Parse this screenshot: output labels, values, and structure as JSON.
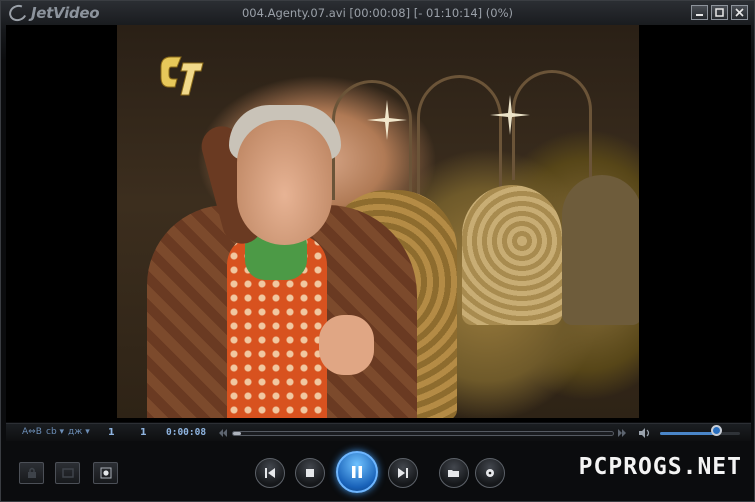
{
  "app": {
    "name": "JetVideo"
  },
  "window": {
    "title": "004.Agenty.07.avi [00:00:08] [- 01:10:14] (0%)"
  },
  "window_controls": {
    "minimize": "minimize-icon",
    "restore": "restore-icon",
    "close": "close-icon"
  },
  "seekbar": {
    "ab_label": "A⇔B",
    "subtitle_label": "cb ▾",
    "audio_label": "дж ▾",
    "num1": "1",
    "num2": "1",
    "time": "0:00:08",
    "progress": 0.02,
    "volume": 0.7
  },
  "watermark": "PCPROGS.NET",
  "colors": {
    "accent": "#2a6fbf",
    "text_blue": "#8fb4e0"
  }
}
